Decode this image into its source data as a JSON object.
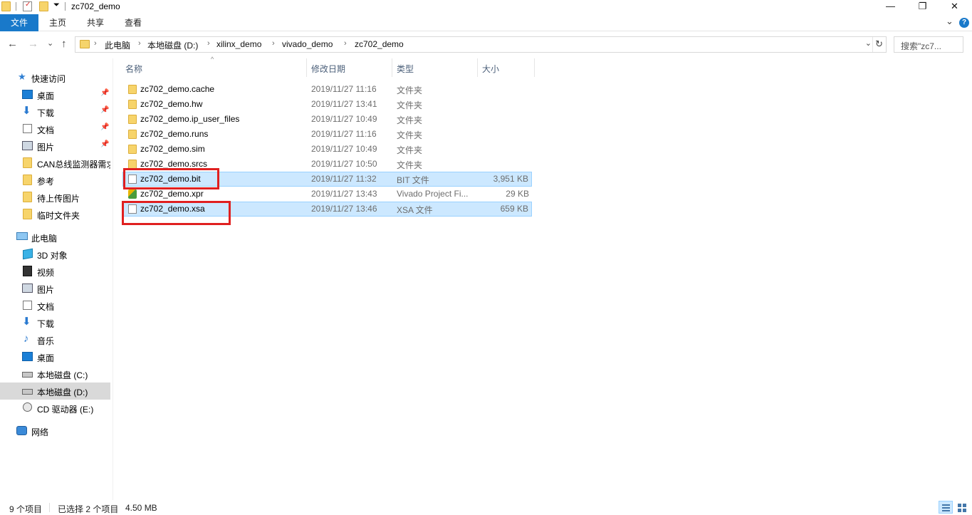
{
  "window": {
    "title": "zc702_demo",
    "minimize_glyph": "—",
    "maximize_glyph": "❐",
    "close_glyph": "✕"
  },
  "ribbon": {
    "tabs": [
      "文件",
      "主页",
      "共享",
      "查看"
    ],
    "expand_glyph": "⌄",
    "help_glyph": "?"
  },
  "nav": {
    "back_glyph": "←",
    "forward_glyph": "→",
    "recent_glyph": "⌄",
    "up_glyph": "↑",
    "breadcrumb": [
      "此电脑",
      "本地磁盘 (D:)",
      "xilinx_demo",
      "vivado_demo",
      "zc702_demo"
    ],
    "breadcrumb_sep": "›",
    "dropdown_glyph": "⌄",
    "refresh_glyph": "↻",
    "search_placeholder": "搜索\"zc7..."
  },
  "sidebar": {
    "quick_access": "快速访问",
    "pin_glyph": "📌",
    "items": [
      {
        "label": "桌面",
        "icon": "desktop-icon",
        "pinned": true
      },
      {
        "label": "下载",
        "icon": "download-icon",
        "pinned": true
      },
      {
        "label": "文档",
        "icon": "document-icon",
        "pinned": true
      },
      {
        "label": "图片",
        "icon": "picture-icon",
        "pinned": true
      },
      {
        "label": "CAN总线监测器需求",
        "icon": "folder-icon",
        "pinned": false
      },
      {
        "label": "参考",
        "icon": "folder-icon",
        "pinned": false
      },
      {
        "label": "待上传图片",
        "icon": "folder-icon",
        "pinned": false
      },
      {
        "label": "临时文件夹",
        "icon": "folder-icon",
        "pinned": false
      }
    ],
    "this_pc": "此电脑",
    "pc_items": [
      {
        "label": "3D 对象",
        "icon": "3d-objects-icon"
      },
      {
        "label": "视频",
        "icon": "video-icon"
      },
      {
        "label": "图片",
        "icon": "picture-icon"
      },
      {
        "label": "文档",
        "icon": "document-icon"
      },
      {
        "label": "下载",
        "icon": "download-icon"
      },
      {
        "label": "音乐",
        "icon": "music-icon"
      },
      {
        "label": "桌面",
        "icon": "desktop-icon"
      },
      {
        "label": "本地磁盘 (C:)",
        "icon": "drive-icon"
      },
      {
        "label": "本地磁盘 (D:)",
        "icon": "drive-icon",
        "selected": true
      },
      {
        "label": "CD 驱动器 (E:)",
        "icon": "cd-drive-icon"
      }
    ],
    "network": "网络"
  },
  "columns": {
    "name": "名称",
    "date": "修改日期",
    "type": "类型",
    "size": "大小",
    "sort_glyph": "^"
  },
  "files": [
    {
      "name": "zc702_demo.cache",
      "date": "2019/11/27 11:16",
      "type": "文件夹",
      "size": "",
      "kind": "folder"
    },
    {
      "name": "zc702_demo.hw",
      "date": "2019/11/27 13:41",
      "type": "文件夹",
      "size": "",
      "kind": "folder"
    },
    {
      "name": "zc702_demo.ip_user_files",
      "date": "2019/11/27 10:49",
      "type": "文件夹",
      "size": "",
      "kind": "folder"
    },
    {
      "name": "zc702_demo.runs",
      "date": "2019/11/27 11:16",
      "type": "文件夹",
      "size": "",
      "kind": "folder"
    },
    {
      "name": "zc702_demo.sim",
      "date": "2019/11/27 10:49",
      "type": "文件夹",
      "size": "",
      "kind": "folder"
    },
    {
      "name": "zc702_demo.srcs",
      "date": "2019/11/27 10:50",
      "type": "文件夹",
      "size": "",
      "kind": "folder"
    },
    {
      "name": "zc702_demo.bit",
      "date": "2019/11/27 11:32",
      "type": "BIT 文件",
      "size": "3,951 KB",
      "kind": "file",
      "selected": true
    },
    {
      "name": "zc702_demo.xpr",
      "date": "2019/11/27 13:43",
      "type": "Vivado Project Fi...",
      "size": "29 KB",
      "kind": "xpr"
    },
    {
      "name": "zc702_demo.xsa",
      "date": "2019/11/27 13:46",
      "type": "XSA 文件",
      "size": "659 KB",
      "kind": "file",
      "selected": true
    }
  ],
  "annotation_color": "#e02020",
  "status": {
    "count": "9 个项目",
    "selected": "已选择 2 个项目",
    "size": "4.50 MB"
  }
}
